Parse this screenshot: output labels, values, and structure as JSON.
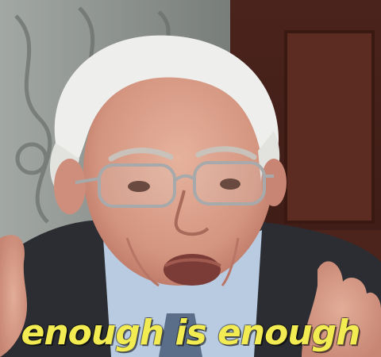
{
  "caption": {
    "text": "enough is enough",
    "color": "#f2ec52"
  },
  "scene": {
    "subject": "elderly man with white hair and glasses gesturing with both hands",
    "colors": {
      "wall_left": "#8f9490",
      "wall_right": "#5a2d24",
      "suit": "#2b2d33",
      "shirt": "#b9cbe0",
      "skin": "#d8a08a",
      "hair": "#eeeeec"
    }
  }
}
